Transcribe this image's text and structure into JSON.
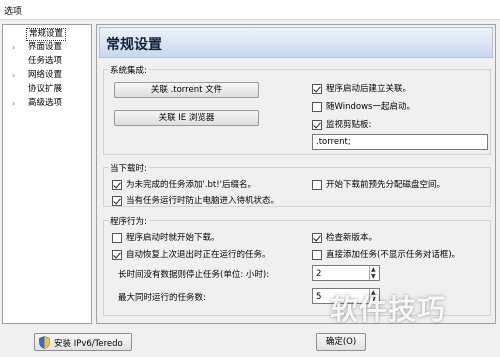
{
  "window": {
    "title": "选项"
  },
  "tree": {
    "items": [
      {
        "label": "常规设置",
        "expand": "",
        "selected": true
      },
      {
        "label": "界面设置",
        "expand": "›",
        "selected": false
      },
      {
        "label": "任务选项",
        "expand": "",
        "selected": false
      },
      {
        "label": "网络设置",
        "expand": "›",
        "selected": false
      },
      {
        "label": "协议扩展",
        "expand": "",
        "selected": false
      },
      {
        "label": "高级选项",
        "expand": "›",
        "selected": false
      }
    ]
  },
  "header": {
    "title": "常规设置"
  },
  "system": {
    "label": "系统集成:",
    "assoc_torrent_button": "关联 .torrent 文件",
    "assoc_ie_button": "关联 IE 浏览器",
    "create_assoc_on_start": {
      "label": "程序启动后建立关联。",
      "checked": true
    },
    "start_with_windows": {
      "label": "随Windows一起启动。",
      "checked": false
    },
    "monitor_clipboard": {
      "label": "监视剪贴板:",
      "checked": true
    },
    "clipboard_value": ".torrent;"
  },
  "download": {
    "label": "当下载时:",
    "add_bt_suffix": {
      "label": "为未完成的任务添加'.bt!'后缀名。",
      "checked": true
    },
    "prealloc_disk": {
      "label": "开始下载前预先分配磁盘空间。",
      "checked": false
    },
    "prevent_sleep": {
      "label": "当有任务运行时防止电脑进入待机状态。",
      "checked": true
    }
  },
  "behavior": {
    "label": "程序行为:",
    "auto_download_on_start": {
      "label": "程序启动时就开始下载。",
      "checked": false
    },
    "check_new_version": {
      "label": "检查新版本。",
      "checked": true
    },
    "auto_resume": {
      "label": "自动恢复上次退出时正在运行的任务。",
      "checked": true
    },
    "add_directly": {
      "label": "直接添加任务(不显示任务对话框)。",
      "checked": false
    },
    "idle_stop_label": "长时间没有数据则停止任务(单位: 小时):",
    "idle_stop_value": "2",
    "max_tasks_label": "最大同时运行的任务数:",
    "max_tasks_value": "5"
  },
  "footer": {
    "install_ipv6_button": "安装 IPv6/Teredo",
    "ok_button": "确定(O)"
  },
  "watermark": "软件技巧"
}
